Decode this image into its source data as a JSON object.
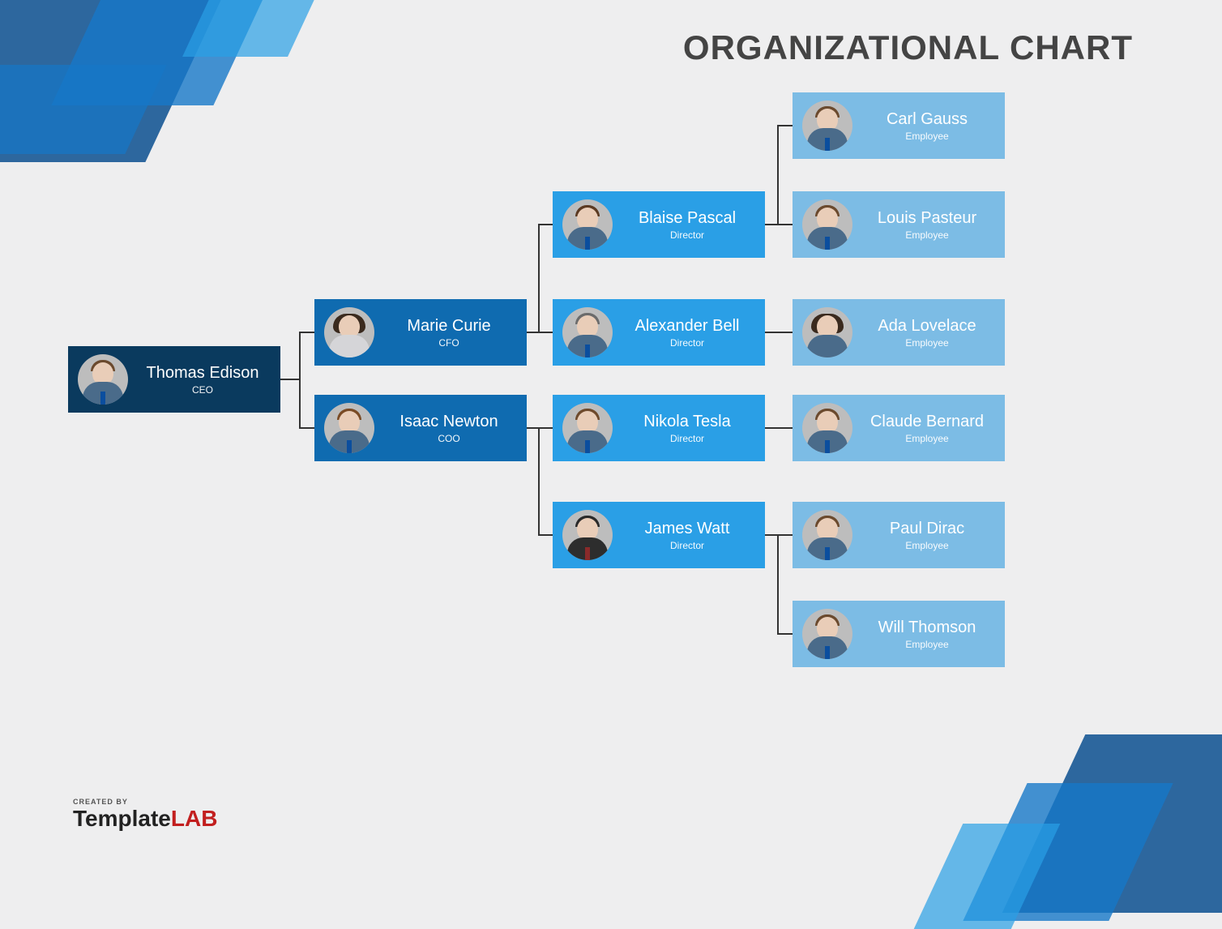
{
  "title": "ORGANIZATIONAL CHART",
  "brand": {
    "created_by": "CREATED BY",
    "name_part1": "Template",
    "name_part2": "L",
    "name_part3": "A",
    "name_part4": "B"
  },
  "chart_data": {
    "type": "org-chart",
    "root": {
      "name": "Thomas Edison",
      "role": "CEO",
      "children": [
        {
          "name": "Marie Curie",
          "role": "CFO",
          "children": [
            {
              "name": "Blaise Pascal",
              "role": "Director",
              "children": [
                {
                  "name": "Carl Gauss",
                  "role": "Employee"
                },
                {
                  "name": "Louis Pasteur",
                  "role": "Employee"
                }
              ]
            },
            {
              "name": "Alexander Bell",
              "role": "Director",
              "children": [
                {
                  "name": "Ada Lovelace",
                  "role": "Employee"
                }
              ]
            }
          ]
        },
        {
          "name": "Isaac Newton",
          "role": "COO",
          "children": [
            {
              "name": "Nikola Tesla",
              "role": "Director",
              "children": [
                {
                  "name": "Claude Bernard",
                  "role": "Employee"
                }
              ]
            },
            {
              "name": "James Watt",
              "role": "Director",
              "children": [
                {
                  "name": "Paul Dirac",
                  "role": "Employee"
                },
                {
                  "name": "Will Thomson",
                  "role": "Employee"
                }
              ]
            }
          ]
        }
      ]
    }
  },
  "cards": {
    "ceo": {
      "name": "Thomas Edison",
      "role": "CEO"
    },
    "cfo": {
      "name": "Marie Curie",
      "role": "CFO"
    },
    "coo": {
      "name": "Isaac Newton",
      "role": "COO"
    },
    "d1": {
      "name": "Blaise Pascal",
      "role": "Director"
    },
    "d2": {
      "name": "Alexander Bell",
      "role": "Director"
    },
    "d3": {
      "name": "Nikola Tesla",
      "role": "Director"
    },
    "d4": {
      "name": "James Watt",
      "role": "Director"
    },
    "e1": {
      "name": "Carl Gauss",
      "role": "Employee"
    },
    "e2": {
      "name": "Louis Pasteur",
      "role": "Employee"
    },
    "e3": {
      "name": "Ada Lovelace",
      "role": "Employee"
    },
    "e4": {
      "name": "Claude Bernard",
      "role": "Employee"
    },
    "e5": {
      "name": "Paul Dirac",
      "role": "Employee"
    },
    "e6": {
      "name": "Will Thomson",
      "role": "Employee"
    }
  }
}
